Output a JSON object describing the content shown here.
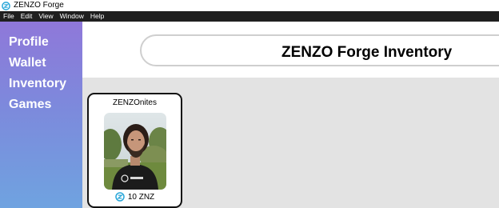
{
  "window": {
    "title": "ZENZO Forge",
    "menu": [
      "File",
      "Edit",
      "View",
      "Window",
      "Help"
    ]
  },
  "sidebar": {
    "items": [
      {
        "label": "Profile"
      },
      {
        "label": "Wallet"
      },
      {
        "label": "Inventory"
      },
      {
        "label": "Games"
      }
    ]
  },
  "header": {
    "title": "ZENZO Forge Inventory"
  },
  "inventory": {
    "items": [
      {
        "name": "ZENZOnites",
        "image": "portrait-photo",
        "price": "10 ZNZ",
        "price_icon": "znz-coin-icon"
      }
    ]
  },
  "colors": {
    "menubar_bg": "#1f1f1f",
    "sidebar_gradient_top": "#8f78d9",
    "sidebar_gradient_bottom": "#6fa3e0",
    "content_bg": "#e3e3e3",
    "coin_accent": "#2aa7d9"
  }
}
